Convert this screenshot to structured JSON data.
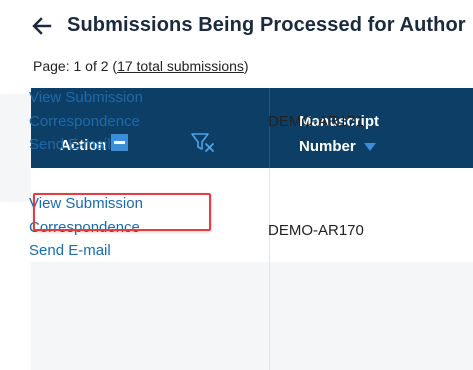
{
  "header": {
    "title": "Submissions Being Processed for Author"
  },
  "pagination": {
    "prefix": "Page: 1 of 2 (",
    "total_link": "17 total submissions",
    "suffix": ")"
  },
  "table": {
    "headers": {
      "action": "Action",
      "manuscript_line1": "Manuscript",
      "manuscript_line2": "Number"
    },
    "rows": [
      {
        "actions": [
          "View Submission",
          "Correspondence",
          "Send E-mail"
        ],
        "manuscript_number": "DEMO-AR171"
      },
      {
        "actions": [
          "View Submission",
          "Correspondence",
          "Send E-mail"
        ],
        "manuscript_number": "DEMO-AR170"
      }
    ]
  },
  "colors": {
    "header_bg": "#0d3f66",
    "link": "#1f6aa8",
    "accent": "#3b8fd6",
    "highlight": "#e43d3d"
  },
  "icons": {
    "back": "arrow-left-icon",
    "collapse": "minus-square-icon",
    "filter_clear": "filter-clear-icon",
    "sort": "sort-down-icon"
  }
}
